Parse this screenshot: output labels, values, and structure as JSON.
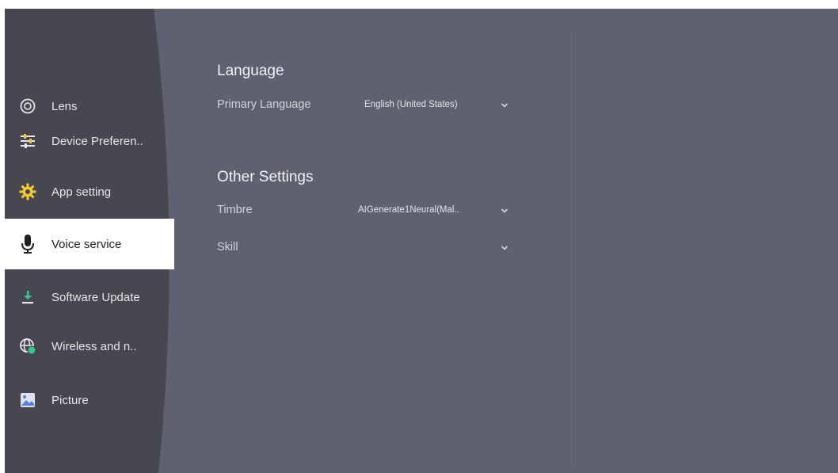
{
  "sidebar": {
    "items": [
      {
        "label": "Lens",
        "icon": "lens-icon"
      },
      {
        "label": "Device Preferen..",
        "icon": "sliders-icon"
      },
      {
        "label": "App setting",
        "icon": "gear-icon"
      },
      {
        "label": "Voice service",
        "icon": "microphone-icon",
        "active": true
      },
      {
        "label": "Software Update",
        "icon": "download-icon"
      },
      {
        "label": "Wireless and n..",
        "icon": "globe-network-icon"
      },
      {
        "label": "Picture",
        "icon": "picture-icon"
      }
    ]
  },
  "main": {
    "language": {
      "title": "Language",
      "primary_label": "Primary Language",
      "primary_value": "English (United States)"
    },
    "other": {
      "title": "Other Settings",
      "timbre_label": "Timbre",
      "timbre_value": "AIGenerate1Neural(Mal..",
      "skill_label": "Skill",
      "skill_value": ""
    }
  },
  "colors": {
    "background": "#5f6170",
    "sidebar": "#46474f",
    "active_item": "#ffffff",
    "accent_yellow": "#f4c83a",
    "accent_green": "#3ec78c"
  }
}
